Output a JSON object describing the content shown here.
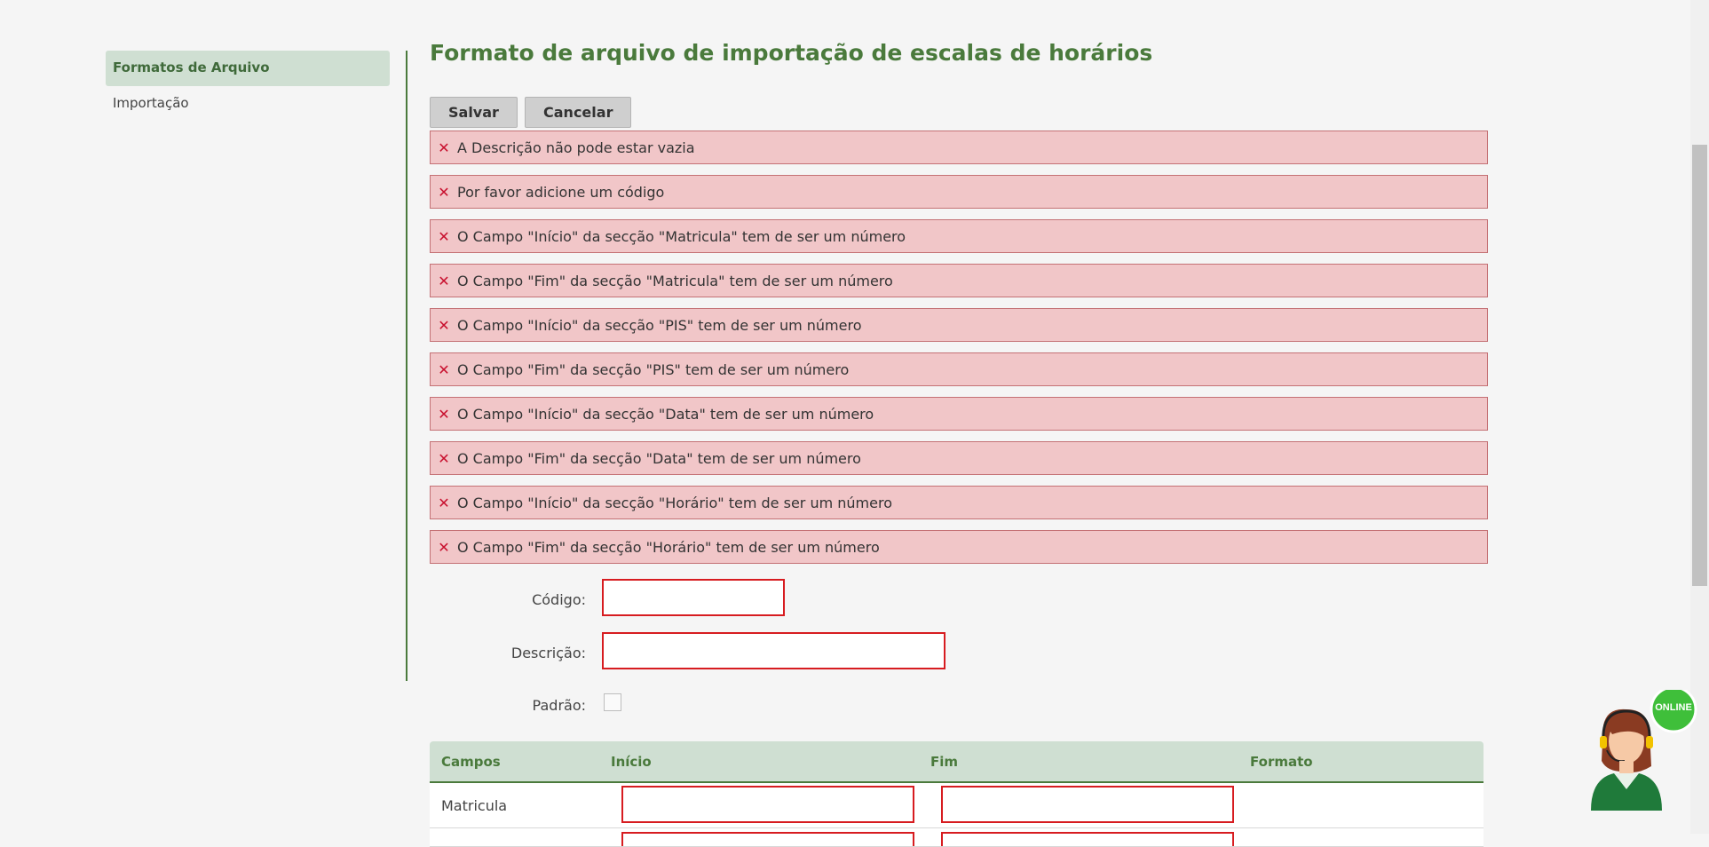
{
  "sidebar": {
    "items": [
      {
        "label": "Formatos de Arquivo",
        "active": true
      },
      {
        "label": "Importação",
        "active": false
      }
    ]
  },
  "main": {
    "title": "Formato de arquivo de importação de escalas de horários",
    "toolbar": {
      "save_label": "Salvar",
      "cancel_label": "Cancelar"
    },
    "errors": [
      "A Descrição não pode estar vazia",
      "Por favor adicione um código",
      "O Campo \"Início\" da secção \"Matricula\" tem de ser um número",
      "O Campo \"Fim\" da secção \"Matricula\" tem de ser um número",
      "O Campo \"Início\" da secção \"PIS\" tem de ser um número",
      "O Campo \"Fim\" da secção \"PIS\" tem de ser um número",
      "O Campo \"Início\" da secção \"Data\" tem de ser um número",
      "O Campo \"Fim\" da secção \"Data\" tem de ser um número",
      "O Campo \"Início\" da secção \"Horário\" tem de ser um número",
      "O Campo \"Fim\" da secção \"Horário\" tem de ser um número"
    ],
    "form": {
      "codigo_label": "Código:",
      "codigo_value": "",
      "descricao_label": "Descrição:",
      "descricao_value": "",
      "padrao_label": "Padrão:"
    },
    "table": {
      "headers": [
        "Campos",
        "Início",
        "Fim",
        "Formato"
      ],
      "rows": [
        {
          "label": "Matricula",
          "inicio": "",
          "fim": ""
        }
      ]
    }
  },
  "chat_badge": {
    "status": "ONLINE"
  },
  "colors": {
    "accent_green": "#4a7a3c",
    "error_bg": "#f1c6c8",
    "error_x": "#c8102e",
    "online_green": "#3fbf3a"
  },
  "icons": [
    "close-icon",
    "support-agent-icon"
  ]
}
